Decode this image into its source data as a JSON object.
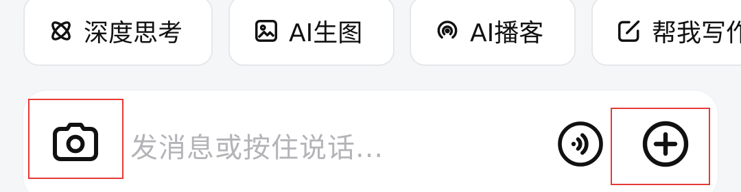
{
  "quick_actions": [
    {
      "label": "深度思考",
      "icon": "atom-icon"
    },
    {
      "label": "AI生图",
      "icon": "image-icon"
    },
    {
      "label": "AI播客",
      "icon": "podcast-icon"
    },
    {
      "label": "帮我写作",
      "icon": "edit-icon"
    }
  ],
  "composer": {
    "placeholder": "发消息或按住说话...",
    "left_button_icon": "camera-icon",
    "voice_button_icon": "voice-icon",
    "right_button_icon": "plus-icon"
  },
  "highlight_color": "#e53935"
}
